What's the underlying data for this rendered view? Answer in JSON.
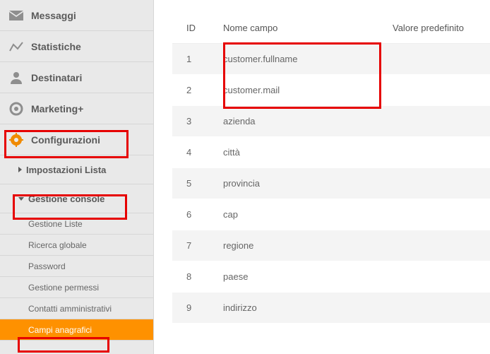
{
  "sidebar": {
    "nav": [
      {
        "key": "messaggi",
        "label": "Messaggi",
        "icon": "mail-icon"
      },
      {
        "key": "statistiche",
        "label": "Statistiche",
        "icon": "stats-icon"
      },
      {
        "key": "destinatari",
        "label": "Destinatari",
        "icon": "user-icon"
      },
      {
        "key": "marketing",
        "label": "Marketing+",
        "icon": "target-icon"
      },
      {
        "key": "configurazioni",
        "label": "Configurazioni",
        "icon": "gear-icon"
      }
    ],
    "sections": [
      {
        "key": "impostazioni-lista",
        "label": "Impostazioni Lista",
        "expanded": false
      },
      {
        "key": "gestione-console",
        "label": "Gestione console",
        "expanded": true,
        "items": [
          {
            "key": "gestione-liste",
            "label": "Gestione Liste",
            "active": false
          },
          {
            "key": "ricerca-globale",
            "label": "Ricerca globale",
            "active": false
          },
          {
            "key": "password",
            "label": "Password",
            "active": false
          },
          {
            "key": "gestione-permessi",
            "label": "Gestione permessi",
            "active": false
          },
          {
            "key": "contatti-amministrativi",
            "label": "Contatti amministrativi",
            "active": false
          },
          {
            "key": "campi-anagrafici",
            "label": "Campi anagrafici",
            "active": true
          }
        ]
      }
    ]
  },
  "table": {
    "headers": {
      "id": "ID",
      "name": "Nome campo",
      "default": "Valore predefinito"
    },
    "rows": [
      {
        "id": "1",
        "name": "customer.fullname",
        "default": ""
      },
      {
        "id": "2",
        "name": "customer.mail",
        "default": ""
      },
      {
        "id": "3",
        "name": "azienda",
        "default": ""
      },
      {
        "id": "4",
        "name": "città",
        "default": ""
      },
      {
        "id": "5",
        "name": "provincia",
        "default": ""
      },
      {
        "id": "6",
        "name": "cap",
        "default": ""
      },
      {
        "id": "7",
        "name": "regione",
        "default": ""
      },
      {
        "id": "8",
        "name": "paese",
        "default": ""
      },
      {
        "id": "9",
        "name": "indirizzo",
        "default": ""
      }
    ]
  },
  "colors": {
    "accent": "#fe9100",
    "highlight": "#e60000"
  }
}
